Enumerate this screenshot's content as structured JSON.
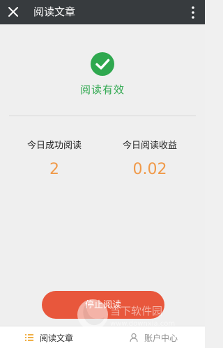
{
  "header": {
    "title": "阅读文章"
  },
  "status": {
    "text": "阅读有效"
  },
  "stats": [
    {
      "label": "今日成功阅读",
      "value": "2"
    },
    {
      "label": "今日阅读收益",
      "value": "0.02"
    }
  ],
  "actions": {
    "stop_label": "停止阅读"
  },
  "bottom_nav": [
    {
      "label": "阅读文章",
      "icon": "list-icon"
    },
    {
      "label": "账户中心",
      "icon": "user-icon"
    }
  ],
  "watermark": {
    "brand": "当下软件园",
    "url": "www.downxia.com"
  },
  "colors": {
    "header_bg": "#373b3e",
    "success": "#2fa84f",
    "value": "#f09a4a",
    "button": "#e8573c",
    "nav_active": "#f0b047"
  }
}
